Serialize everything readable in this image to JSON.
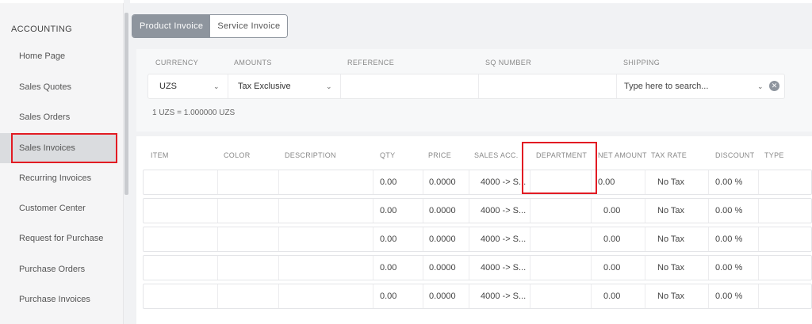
{
  "sidebar": {
    "section_title": "ACCOUNTING",
    "items": [
      {
        "label": "Home Page"
      },
      {
        "label": "Sales Quotes"
      },
      {
        "label": "Sales Orders"
      },
      {
        "label": "Sales Invoices",
        "active": true
      },
      {
        "label": "Recurring Invoices"
      },
      {
        "label": "Customer Center"
      },
      {
        "label": "Request for Purchase"
      },
      {
        "label": "Purchase Orders"
      },
      {
        "label": "Purchase Invoices"
      }
    ]
  },
  "tabs": [
    {
      "label": "Product Invoice",
      "active": true
    },
    {
      "label": "Service Invoice",
      "active": false
    }
  ],
  "form": {
    "labels": {
      "currency": "CURRENCY",
      "amounts": "AMOUNTS",
      "reference": "REFERENCE",
      "sq_number": "SQ NUMBER",
      "shipping": "SHIPPING"
    },
    "currency_value": "UZS",
    "amounts_value": "Tax Exclusive",
    "reference_value": "",
    "sq_number_value": "",
    "shipping_placeholder": "Type here to search...",
    "rate_note": "1 UZS = 1.000000 UZS"
  },
  "table": {
    "headers": {
      "item": "ITEM",
      "color": "COLOR",
      "description": "DESCRIPTION",
      "qty": "QTY",
      "price": "PRICE",
      "sales_acc": "SALES ACC.",
      "department": "DEPARTMENT",
      "net_amount": "NET AMOUNT",
      "tax_rate": "TAX RATE",
      "discount": "DISCOUNT",
      "type": "TYPE"
    },
    "rows": [
      {
        "qty": "0.00",
        "price": "0.0000",
        "sales_acc": "4000 -> S...",
        "net_amount": "0.00",
        "tax_rate": "No Tax",
        "discount": "0.00 %"
      },
      {
        "qty": "0.00",
        "price": "0.0000",
        "sales_acc": "4000 -> S...",
        "net_amount": "0.00",
        "tax_rate": "No Tax",
        "discount": "0.00 %"
      },
      {
        "qty": "0.00",
        "price": "0.0000",
        "sales_acc": "4000 -> S...",
        "net_amount": "0.00",
        "tax_rate": "No Tax",
        "discount": "0.00 %"
      },
      {
        "qty": "0.00",
        "price": "0.0000",
        "sales_acc": "4000 -> S...",
        "net_amount": "0.00",
        "tax_rate": "No Tax",
        "discount": "0.00 %"
      },
      {
        "qty": "0.00",
        "price": "0.0000",
        "sales_acc": "4000 -> S...",
        "net_amount": "0.00",
        "tax_rate": "No Tax",
        "discount": "0.00 %"
      }
    ]
  },
  "colors": {
    "highlight": "#e21b23",
    "tab_active": "#8e959e"
  },
  "icons": {
    "dropdown": "chevron-down-icon",
    "clear": "clear-icon"
  }
}
